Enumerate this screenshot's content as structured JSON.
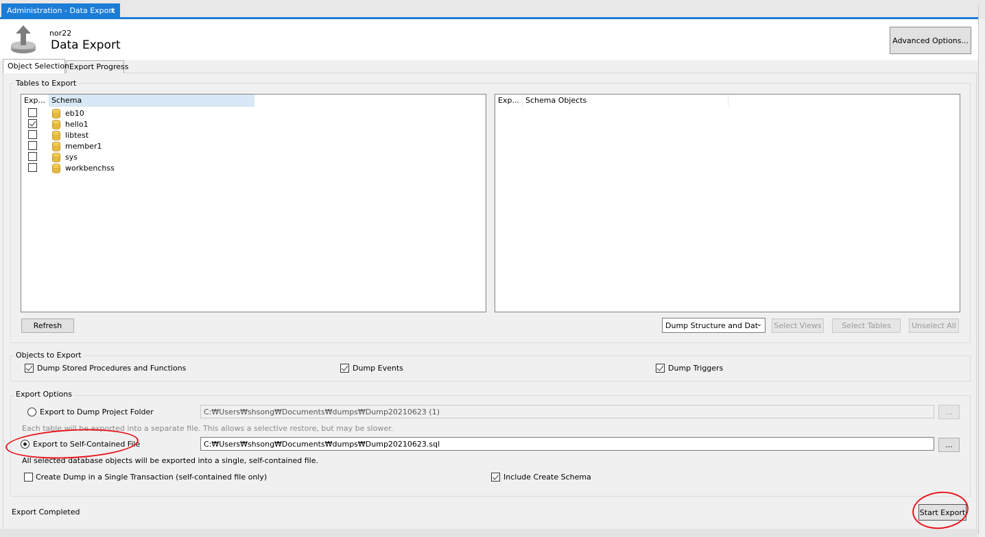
{
  "tab": {
    "title": "Administration - Data Export",
    "close": "×"
  },
  "header": {
    "connection": "nor22",
    "title": "Data Export",
    "advanced_button": "Advanced Options..."
  },
  "inner_tabs": [
    "Object Selection",
    "Export Progress"
  ],
  "tables_to_export": {
    "title": "Tables to Export",
    "schema_list": {
      "col_export": "Exp...",
      "col_schema": "Schema",
      "rows": [
        {
          "name": "eb10",
          "checked": false
        },
        {
          "name": "hello1",
          "checked": true
        },
        {
          "name": "libtest",
          "checked": false
        },
        {
          "name": "member1",
          "checked": false
        },
        {
          "name": "sys",
          "checked": false
        },
        {
          "name": "workbenchss",
          "checked": false
        }
      ]
    },
    "objects_list": {
      "col_export": "Exp...",
      "col_objects": "Schema Objects"
    },
    "refresh_button": "Refresh",
    "dump_select": "Dump Structure and Dat",
    "select_views": "Select Views",
    "select_tables": "Select Tables",
    "unselect_all": "Unselect All"
  },
  "objects_to_export": {
    "title": "Objects to Export",
    "stored_procs": {
      "label": "Dump Stored Procedures and Functions",
      "checked": true
    },
    "events": {
      "label": "Dump Events",
      "checked": true
    },
    "triggers": {
      "label": "Dump Triggers",
      "checked": true
    }
  },
  "export_options": {
    "title": "Export Options",
    "project_folder": {
      "label": "Export to Dump Project Folder",
      "path": "C:₩Users₩shsong₩Documents₩dumps₩Dump20210623 (1)",
      "hint": "Each table will be exported into a separate file. This allows a selective restore, but may be slower.",
      "selected": false
    },
    "self_contained": {
      "label": "Export to Self-Contained File",
      "path": "C:₩Users₩shsong₩Documents₩dumps₩Dump20210623.sql",
      "hint": "All selected database objects will be exported into a single, self-contained file.",
      "selected": true
    },
    "browse": "...",
    "single_transaction": {
      "label": "Create Dump in a Single Transaction (self-contained file only)",
      "checked": false
    },
    "include_schema": {
      "label": "Include Create Schema",
      "checked": true
    }
  },
  "footer": {
    "status": "Export Completed",
    "start_button": "Start Export"
  },
  "colors": {
    "accent": "#1b7dd6",
    "annotation": "#e8141c"
  }
}
